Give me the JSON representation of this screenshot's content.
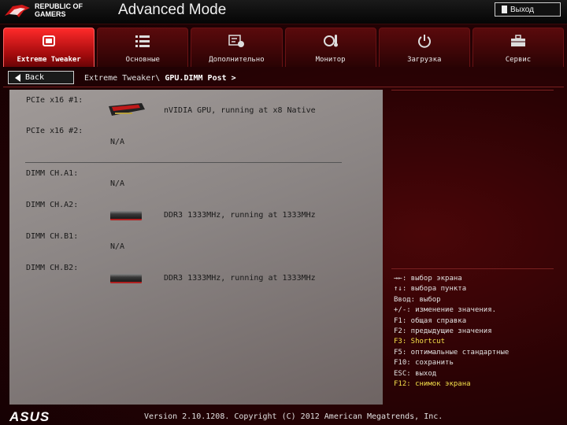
{
  "header": {
    "brand_line1": "REPUBLIC OF",
    "brand_line2": "GAMERS",
    "mode_title": "Advanced Mode",
    "exit_label": "Выход"
  },
  "tabs": [
    {
      "label": "Extreme Tweaker",
      "icon": "tweaker-icon",
      "active": true
    },
    {
      "label": "Основные",
      "icon": "list-icon",
      "active": false
    },
    {
      "label": "Дополнительно",
      "icon": "advanced-info-icon",
      "active": false
    },
    {
      "label": "Монитор",
      "icon": "monitor-temp-icon",
      "active": false
    },
    {
      "label": "Загрузка",
      "icon": "power-icon",
      "active": false
    },
    {
      "label": "Сервис",
      "icon": "toolbox-icon",
      "active": false
    }
  ],
  "nav": {
    "back_label": "Back",
    "breadcrumb_prefix": "Extreme Tweaker\\",
    "breadcrumb_current": "GPU.DIMM Post >"
  },
  "slots": [
    {
      "label": "PCIe x16 #1:",
      "value": "nVIDIA GPU, running at x8 Native",
      "device": "gpu"
    },
    {
      "label": "PCIe x16 #2:",
      "value": "N/A",
      "device": "none"
    },
    {
      "label": "DIMM CH.A1:",
      "value": "N/A",
      "device": "none"
    },
    {
      "label": "DIMM CH.A2:",
      "value": "DDR3 1333MHz, running at 1333MHz",
      "device": "ram"
    },
    {
      "label": "DIMM CH.B1:",
      "value": "N/A",
      "device": "none"
    },
    {
      "label": "DIMM CH.B2:",
      "value": "DDR3 1333MHz, running at 1333MHz",
      "device": "ram"
    }
  ],
  "help": [
    {
      "text": "→←: выбор экрана",
      "highlight": false
    },
    {
      "text": "↑↓: выбора пункта",
      "highlight": false
    },
    {
      "text": "Ввод: выбор",
      "highlight": false
    },
    {
      "text": "+/-: изменение значения.",
      "highlight": false
    },
    {
      "text": "F1: общая справка",
      "highlight": false
    },
    {
      "text": "F2: предыдущие значения",
      "highlight": false
    },
    {
      "text": "F3: Shortcut",
      "highlight": true
    },
    {
      "text": "F5: оптимальные стандартные",
      "highlight": false
    },
    {
      "text": "F10: сохранить",
      "highlight": false
    },
    {
      "text": "ESC: выход",
      "highlight": false
    },
    {
      "text": "F12: снимок экрана",
      "highlight": true
    }
  ],
  "footer": {
    "logo": "ASUS",
    "version": "Version 2.10.1208. Copyright (C) 2012 American Megatrends, Inc."
  },
  "colors": {
    "accent": "#e01a1a",
    "highlight": "#f4e04a",
    "panel": "#8a8483"
  }
}
